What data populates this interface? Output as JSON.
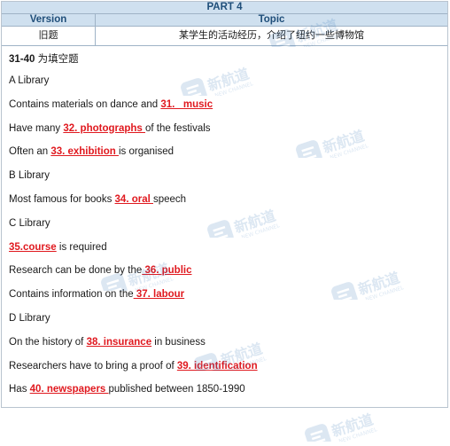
{
  "header": {
    "part": "PART 4"
  },
  "columns": {
    "version": "Version",
    "topic": "Topic"
  },
  "meta": {
    "version_value": "旧题",
    "topic_value": "某学生的活动经历，介绍了纽约一些博物馆"
  },
  "intro": {
    "range": "31-40",
    "label": " 为填空题"
  },
  "lines": [
    {
      "pre": "A Library",
      "ans": "",
      "post": ""
    },
    {
      "pre": "Contains materials on dance and ",
      "ans": "31.   music",
      "post": ""
    },
    {
      "pre": "Have many ",
      "ans": "32. photographs ",
      "post": "of the festivals"
    },
    {
      "pre": "Often an ",
      "ans": "33. exhibition ",
      "post": "is organised"
    },
    {
      "pre": "B Library",
      "ans": "",
      "post": ""
    },
    {
      "pre": "Most famous for books ",
      "ans": "34. oral ",
      "post": "speech"
    },
    {
      "pre": "C Library",
      "ans": "",
      "post": ""
    },
    {
      "pre": "",
      "ans": "35.course",
      "post": " is required"
    },
    {
      "pre": "Research can be done by the",
      "ans": " 36. public",
      "post": ""
    },
    {
      "pre": "Contains information on the",
      "ans": " 37. labour",
      "post": ""
    },
    {
      "pre": "D Library",
      "ans": "",
      "post": ""
    },
    {
      "pre": "On the history of ",
      "ans": "38. insurance",
      "post": " in business"
    },
    {
      "pre": "Researchers have to bring a proof of ",
      "ans": "39. identification",
      "post": ""
    },
    {
      "pre": "Has ",
      "ans": "40. newspapers ",
      "post": "published between 1850-1990"
    }
  ],
  "watermark": {
    "icon": "new-channel-logo",
    "color": "#2a6fb5",
    "text": "新航道",
    "subtext": "NEW CHANNEL"
  },
  "colors": {
    "header_bg": "#cfe0ef",
    "header_text": "#1f4e79",
    "answer": "#e0191f"
  }
}
